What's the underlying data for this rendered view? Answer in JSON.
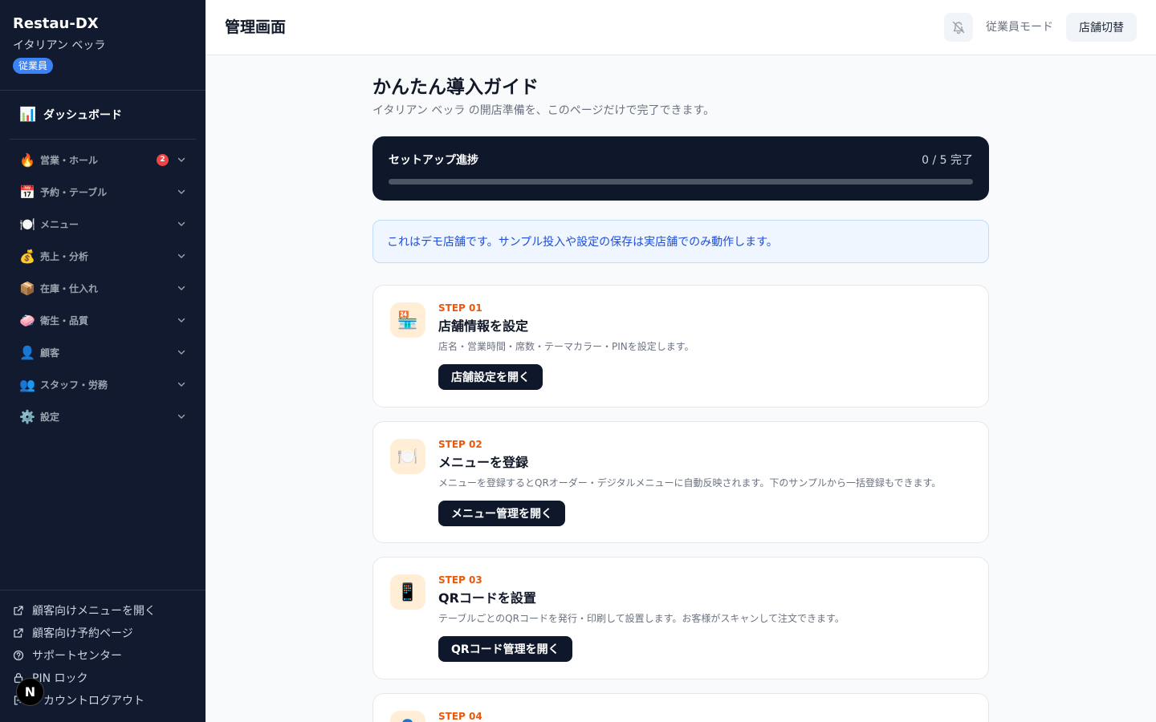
{
  "app": {
    "name": "Restau-DX",
    "store": "イタリアン ベッラ",
    "role": "従業員"
  },
  "sidebar": {
    "dashboard": {
      "icon": "📊",
      "label": "ダッシュボード"
    },
    "groups": [
      {
        "icon": "🔥",
        "label": "営業・ホール",
        "badge": "2"
      },
      {
        "icon": "📅",
        "label": "予約・テーブル"
      },
      {
        "icon": "🍽️",
        "label": "メニュー"
      },
      {
        "icon": "💰",
        "label": "売上・分析"
      },
      {
        "icon": "📦",
        "label": "在庫・仕入れ"
      },
      {
        "icon": "🧼",
        "label": "衛生・品質"
      },
      {
        "icon": "👤",
        "label": "顧客"
      },
      {
        "icon": "👥",
        "label": "スタッフ・労務"
      },
      {
        "icon": "⚙️",
        "label": "設定"
      }
    ],
    "bottom": [
      {
        "label": "顧客向けメニューを開く",
        "icon": "external-link-icon"
      },
      {
        "label": "顧客向け予約ページ",
        "icon": "external-link-icon"
      },
      {
        "label": "サポートセンター",
        "icon": "help-circle-icon"
      },
      {
        "label": "PIN ロック",
        "icon": "lock-icon"
      },
      {
        "label": "アカウントログアウト",
        "icon": "logout-icon"
      }
    ],
    "dev_badge": "N"
  },
  "header": {
    "title": "管理画面",
    "staff_mode": "従業員モード",
    "switch_store": "店舗切替",
    "bell_icon": "bell-off-icon"
  },
  "guide": {
    "title": "かんたん導入ガイド",
    "subtitle": "イタリアン ベッラ の開店準備を、このページだけで完了できます。",
    "progress": {
      "label": "セットアップ進捗",
      "count": "0 / 5 完了",
      "fraction": 0
    },
    "notice": "これはデモ店舗です。サンプル投入や設定の保存は実店舗でのみ動作します。",
    "steps": [
      {
        "num": "STEP 01",
        "icon": "🏪",
        "title": "店舗情報を設定",
        "desc": "店名・営業時間・席数・テーマカラー・PINを設定します。",
        "button": "店舗設定を開く"
      },
      {
        "num": "STEP 02",
        "icon": "🍽️",
        "title": "メニューを登録",
        "desc": "メニューを登録するとQRオーダー・デジタルメニューに自動反映されます。下のサンプルから一括登録もできます。",
        "button": "メニュー管理を開く"
      },
      {
        "num": "STEP 03",
        "icon": "📱",
        "title": "QRコードを設置",
        "desc": "テーブルごとのQRコードを発行・印刷して設置します。お客様がスキャンして注文できます。",
        "button": "QRコード管理を開く"
      },
      {
        "num": "STEP 04",
        "icon": "👤",
        "title": "",
        "desc": "",
        "button": ""
      }
    ]
  },
  "colors": {
    "sidebar_bg": "#111a2e",
    "accent_orange": "#ea580c",
    "dark_button": "#0f172a",
    "info_blue": "#1d4ed8"
  }
}
